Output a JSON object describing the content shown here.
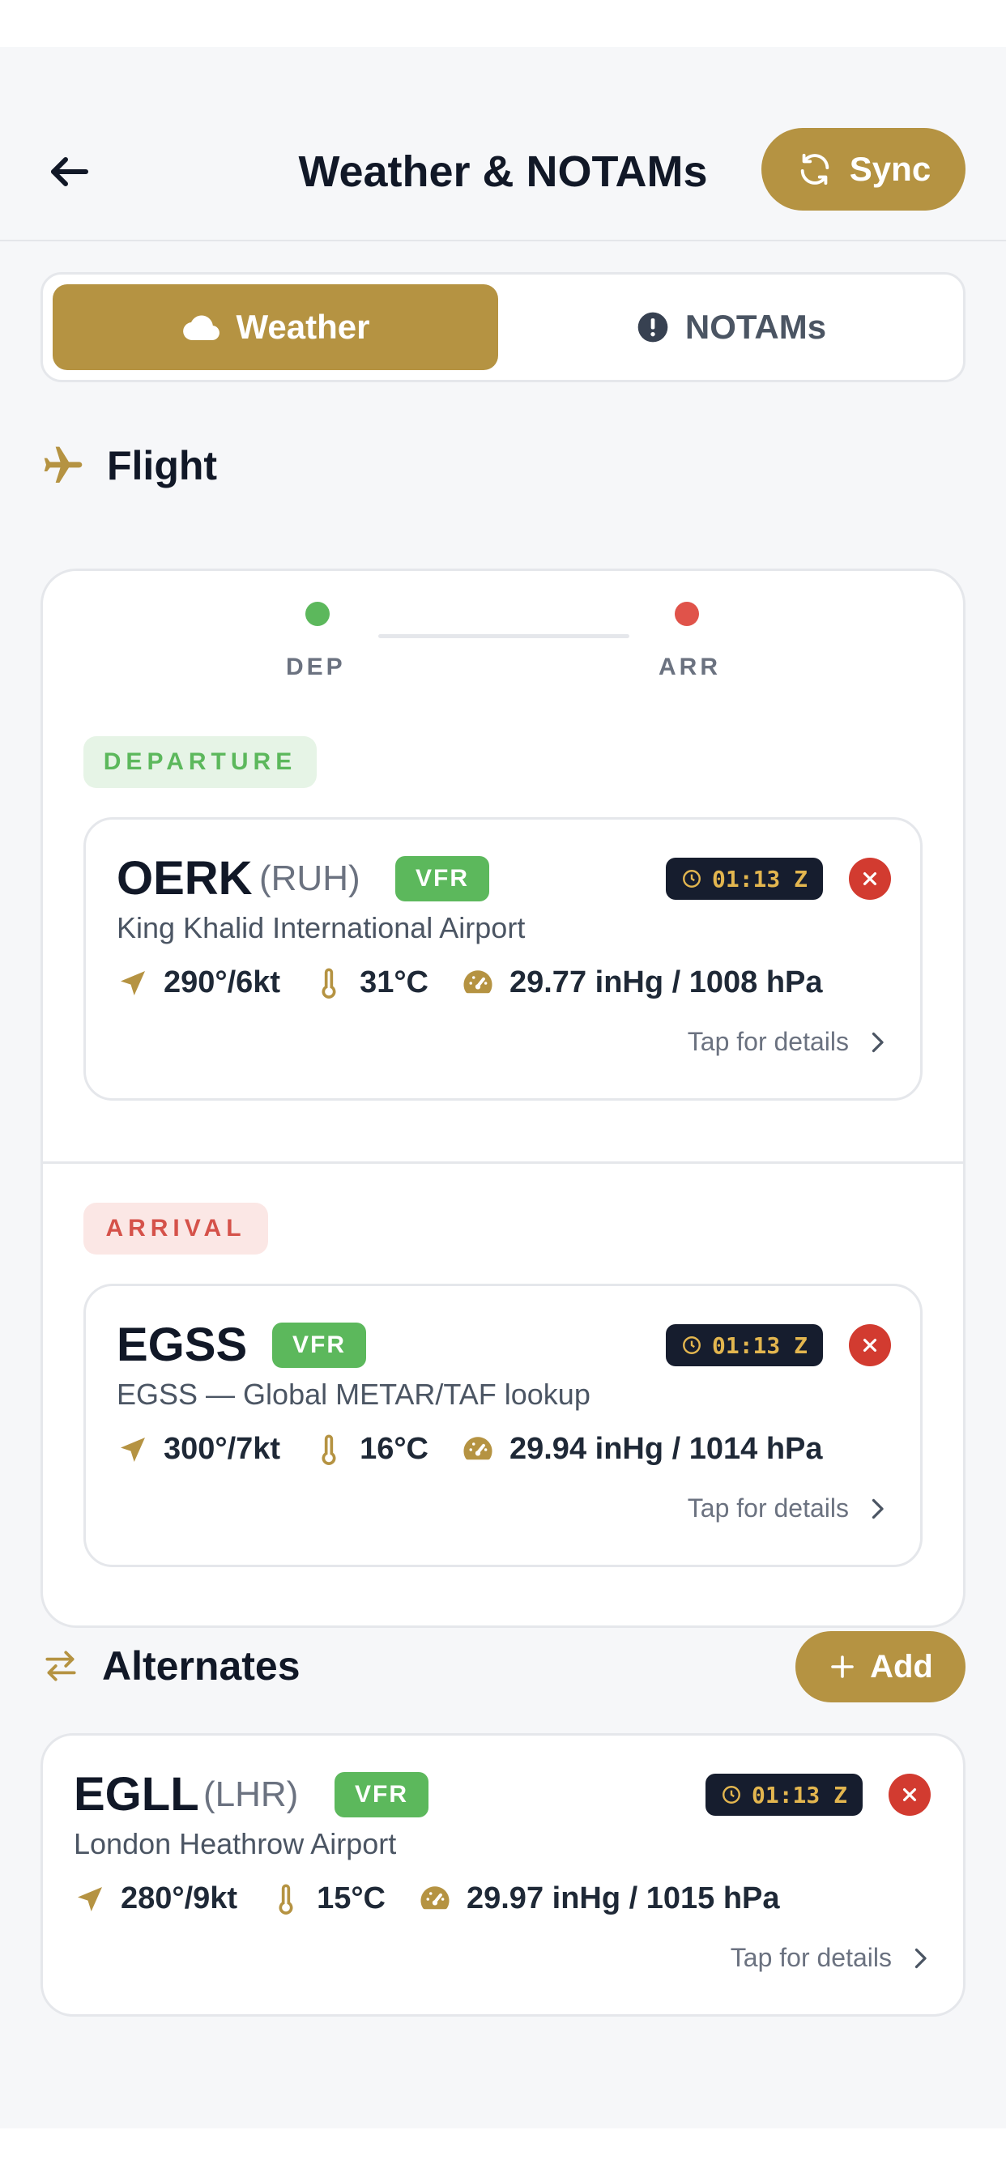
{
  "header": {
    "title": "Weather & NOTAMs",
    "sync_label": "Sync"
  },
  "tabs": {
    "weather": "Weather",
    "notams": "NOTAMs",
    "active": "Weather"
  },
  "flight": {
    "heading": "Flight",
    "route_dep": "DEP",
    "route_arr": "ARR",
    "departure_label": "DEPARTURE",
    "arrival_label": "ARRIVAL",
    "departure": {
      "code": "OERK",
      "iata": "(RUH)",
      "category": "VFR",
      "time": "01:13 Z",
      "name": "King Khalid International Airport",
      "wind": "290°/6kt",
      "temp": "31°C",
      "pressure": "29.77 inHg / 1008 hPa",
      "details": "Tap for details"
    },
    "arrival": {
      "code": "EGSS",
      "category": "VFR",
      "time": "01:13 Z",
      "name": "EGSS — Global METAR/TAF lookup",
      "wind": "300°/7kt",
      "temp": "16°C",
      "pressure": "29.94 inHg / 1014 hPa",
      "details": "Tap for details"
    }
  },
  "alternates": {
    "heading": "Alternates",
    "add_label": "Add",
    "items": [
      {
        "code": "EGLL",
        "iata": "(LHR)",
        "category": "VFR",
        "time": "01:13 Z",
        "name": "London Heathrow Airport",
        "wind": "280°/9kt",
        "temp": "15°C",
        "pressure": "29.97 inHg / 1015 hPa",
        "details": "Tap for details"
      }
    ]
  },
  "colors": {
    "accent": "#b59342",
    "vfr": "#5cb85c",
    "departure": "#5cb85c",
    "arrival": "#e0534a",
    "close": "#d23b30",
    "time_badge_bg": "#161d2e",
    "time_badge_text": "#e3b64f"
  }
}
